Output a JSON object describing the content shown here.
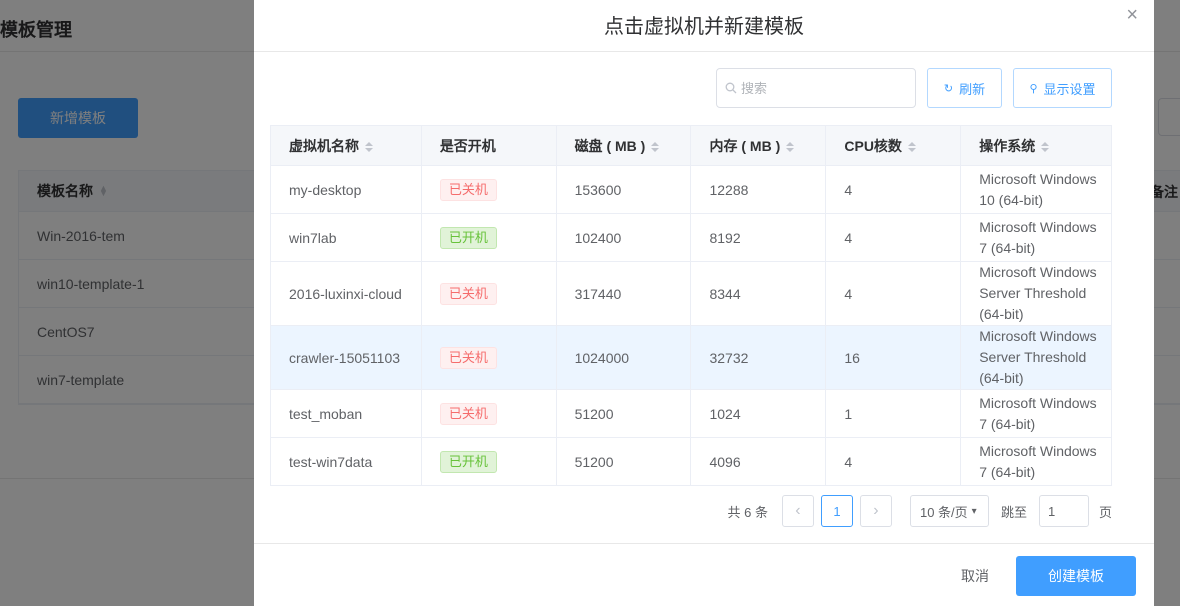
{
  "background": {
    "title": "模板管理",
    "add_button": "新增模板",
    "table_header": "模板名称",
    "note_header": "备注",
    "rows": [
      "Win-2016-tem",
      "win10-template-1",
      "CentOS7",
      "win7-template"
    ]
  },
  "dialog": {
    "title": "点击虚拟机并新建模板",
    "close_icon": "×",
    "search_placeholder": "搜索",
    "refresh_label": "刷新",
    "display_settings_label": "显示设置",
    "columns": [
      "虚拟机名称",
      "是否开机",
      "磁盘 ( MB )",
      "内存 ( MB )",
      "CPU核数",
      "操作系统"
    ],
    "rows": [
      {
        "name": "my-desktop",
        "status": "已关机",
        "status_type": "off",
        "disk": "153600",
        "memory": "12288",
        "cpu": "4",
        "os": "Microsoft Windows 10 (64-bit)"
      },
      {
        "name": "win7lab",
        "status": "已开机",
        "status_type": "on",
        "disk": "102400",
        "memory": "8192",
        "cpu": "4",
        "os": "Microsoft Windows 7 (64-bit)"
      },
      {
        "name": "2016-luxinxi-cloud",
        "status": "已关机",
        "status_type": "off",
        "disk": "317440",
        "memory": "8344",
        "cpu": "4",
        "os": "Microsoft Windows Server Threshold (64-bit)"
      },
      {
        "name": "crawler-15051103",
        "status": "已关机",
        "status_type": "off",
        "disk": "1024000",
        "memory": "32732",
        "cpu": "16",
        "os": "Microsoft Windows Server Threshold (64-bit)"
      },
      {
        "name": "test_moban",
        "status": "已关机",
        "status_type": "off",
        "disk": "51200",
        "memory": "1024",
        "cpu": "1",
        "os": "Microsoft Windows 7 (64-bit)"
      },
      {
        "name": "test-win7data",
        "status": "已开机",
        "status_type": "on",
        "disk": "51200",
        "memory": "4096",
        "cpu": "4",
        "os": "Microsoft Windows 7 (64-bit)"
      }
    ],
    "pagination": {
      "total": "共 6 条",
      "current_page": "1",
      "page_size": "10 条/页",
      "goto_label": "跳至",
      "goto_value": "1",
      "page_suffix": "页"
    },
    "cancel_label": "取消",
    "create_label": "创建模板"
  },
  "colors": {
    "accent": "#409eff",
    "off_tag": "#f56c6c",
    "on_tag": "#67c23a",
    "selected_row": "#ecf5ff"
  }
}
